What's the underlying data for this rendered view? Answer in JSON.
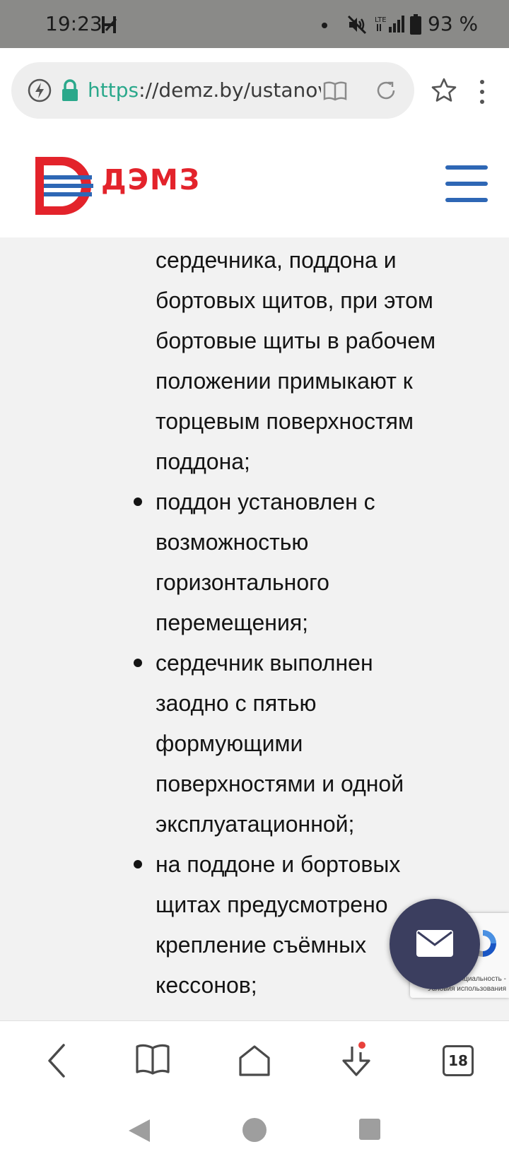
{
  "status_bar": {
    "time": "19:23",
    "battery": "93 %",
    "lte_label": "LTE",
    "icons": [
      "h-notification-icon",
      "dot-icon",
      "mute-icon",
      "lte-signal-icon",
      "battery-icon"
    ]
  },
  "browser": {
    "url_scheme": "https",
    "url_rest": "://demz.by/ustanovl",
    "icons": [
      "flash-icon",
      "lock-icon",
      "reader-icon",
      "reload-icon",
      "star-icon",
      "menu-dots-icon"
    ]
  },
  "site": {
    "logo_text": "ДЭМЗ",
    "brand_color": "#e3232b",
    "accent_color": "#2e67b5"
  },
  "content": {
    "continuation_lines": [
      "сердечника, поддона и",
      "бортовых щитов, при этом",
      "бортовые щиты в рабочем",
      "положении примыкают к",
      "торцевым поверхностям",
      "поддона;"
    ],
    "list_items": [
      {
        "lines": [
          "поддон установлен с",
          "возможностью",
          "горизонтального",
          "перемещения;"
        ]
      },
      {
        "lines": [
          "сердечник выполнен",
          "заодно с пятью",
          "формующими",
          "поверхностями и одной",
          "эксплуатационной;"
        ]
      },
      {
        "lines": [
          "на поддоне и бортовых",
          "щитах предусмотрено",
          "крепление съёмных",
          "кессонов;"
        ]
      }
    ]
  },
  "recaptcha": {
    "line1": "Конфиденциальность -",
    "line2": "Условия использования"
  },
  "bottom_nav": {
    "tabs_count": "18"
  }
}
